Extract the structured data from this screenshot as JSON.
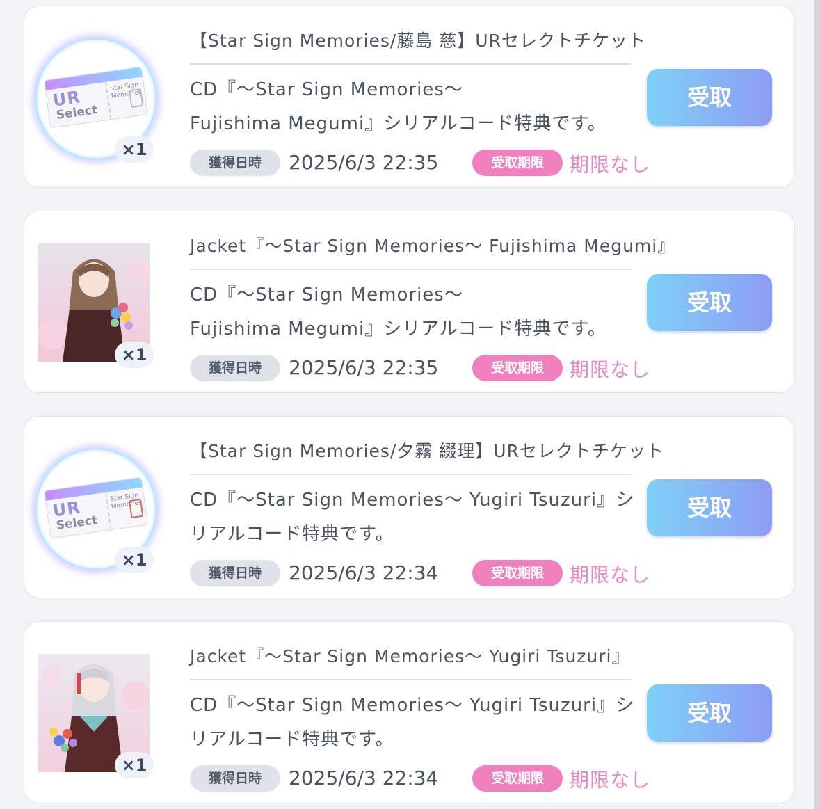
{
  "items": [
    {
      "thumb_kind": "ticket",
      "title": "【Star Sign Memories/藤島 慈】URセレクトチケット",
      "desc_lines": [
        "CD『～Star Sign Memories～",
        " Fujishima Megumi』シリアルコード特典です。"
      ],
      "qty": "×1",
      "acquired_label": "獲得日時",
      "acquired_date": "2025/6/3 22:35",
      "limit_label": "受取期限",
      "limit_value": "期限なし",
      "button_label": "受取",
      "ticket_ur": "UR",
      "ticket_select": "Select",
      "ticket_small": "Star Sign Memories"
    },
    {
      "thumb_kind": "jacket",
      "title": "Jacket『～Star Sign Memories～ Fujishima Megumi』",
      "desc_lines": [
        "CD『～Star Sign Memories～",
        " Fujishima Megumi』シリアルコード特典です。"
      ],
      "qty": "×1",
      "acquired_label": "獲得日時",
      "acquired_date": "2025/6/3 22:35",
      "limit_label": "受取期限",
      "limit_value": "期限なし",
      "button_label": "受取"
    },
    {
      "thumb_kind": "ticket",
      "title": "【Star Sign Memories/夕霧 綴理】URセレクトチケット",
      "desc_lines": [
        "CD『～Star Sign Memories～ Yugiri Tsuzuri』シ",
        "リアルコード特典です。"
      ],
      "qty": "×1",
      "acquired_label": "獲得日時",
      "acquired_date": "2025/6/3 22:34",
      "limit_label": "受取期限",
      "limit_value": "期限なし",
      "button_label": "受取",
      "ticket_ur": "UR",
      "ticket_select": "Select",
      "ticket_small": "Star Sign Memories"
    },
    {
      "thumb_kind": "jacket",
      "title": "Jacket『～Star Sign Memories～ Yugiri Tsuzuri』",
      "desc_lines": [
        "CD『～Star Sign Memories～ Yugiri Tsuzuri』シ",
        "リアルコード特典です。"
      ],
      "qty": "×1",
      "acquired_label": "獲得日時",
      "acquired_date": "2025/6/3 22:34",
      "limit_label": "受取期限",
      "limit_value": "期限なし",
      "button_label": "受取"
    }
  ],
  "colors": {
    "button_gradient_start": "#7fd0f6",
    "button_gradient_end": "#8d9cf3",
    "limit_badge": "#ef7fbd",
    "limit_text": "#e98ac0",
    "acquired_badge": "#dfe2e8"
  }
}
